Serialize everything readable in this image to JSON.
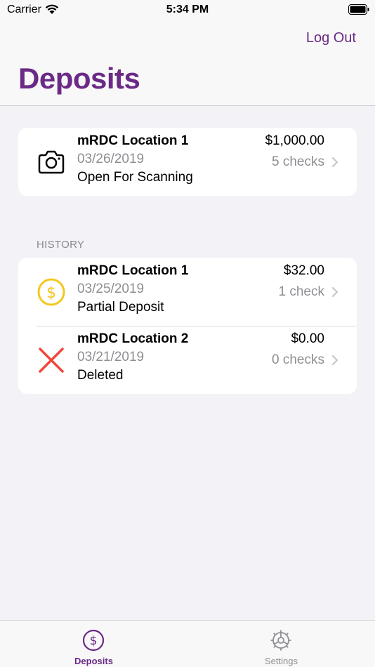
{
  "status_bar": {
    "carrier": "Carrier",
    "time": "5:34 PM"
  },
  "nav": {
    "logout_label": "Log Out",
    "title": "Deposits"
  },
  "colors": {
    "accent": "#6b2a86",
    "gold": "#f2c81f",
    "red": "#f2463b",
    "gray": "#8e8e93"
  },
  "current_deposit": {
    "icon": "camera-icon",
    "name": "mRDC Location 1",
    "date": "03/26/2019",
    "status": "Open For Scanning",
    "amount": "$1,000.00",
    "checks": "5 checks"
  },
  "history": {
    "header": "HISTORY",
    "items": [
      {
        "icon": "dollar-coin-icon",
        "name": "mRDC Location 1",
        "date": "03/25/2019",
        "status": "Partial Deposit",
        "amount": "$32.00",
        "checks": "1 check"
      },
      {
        "icon": "x-mark-icon",
        "name": "mRDC Location 2",
        "date": "03/21/2019",
        "status": "Deleted",
        "amount": "$0.00",
        "checks": "0 checks"
      }
    ]
  },
  "tab_bar": {
    "tabs": [
      {
        "label": "Deposits",
        "icon": "dollar-circle-icon",
        "selected": true
      },
      {
        "label": "Settings",
        "icon": "gear-icon",
        "selected": false
      }
    ]
  }
}
